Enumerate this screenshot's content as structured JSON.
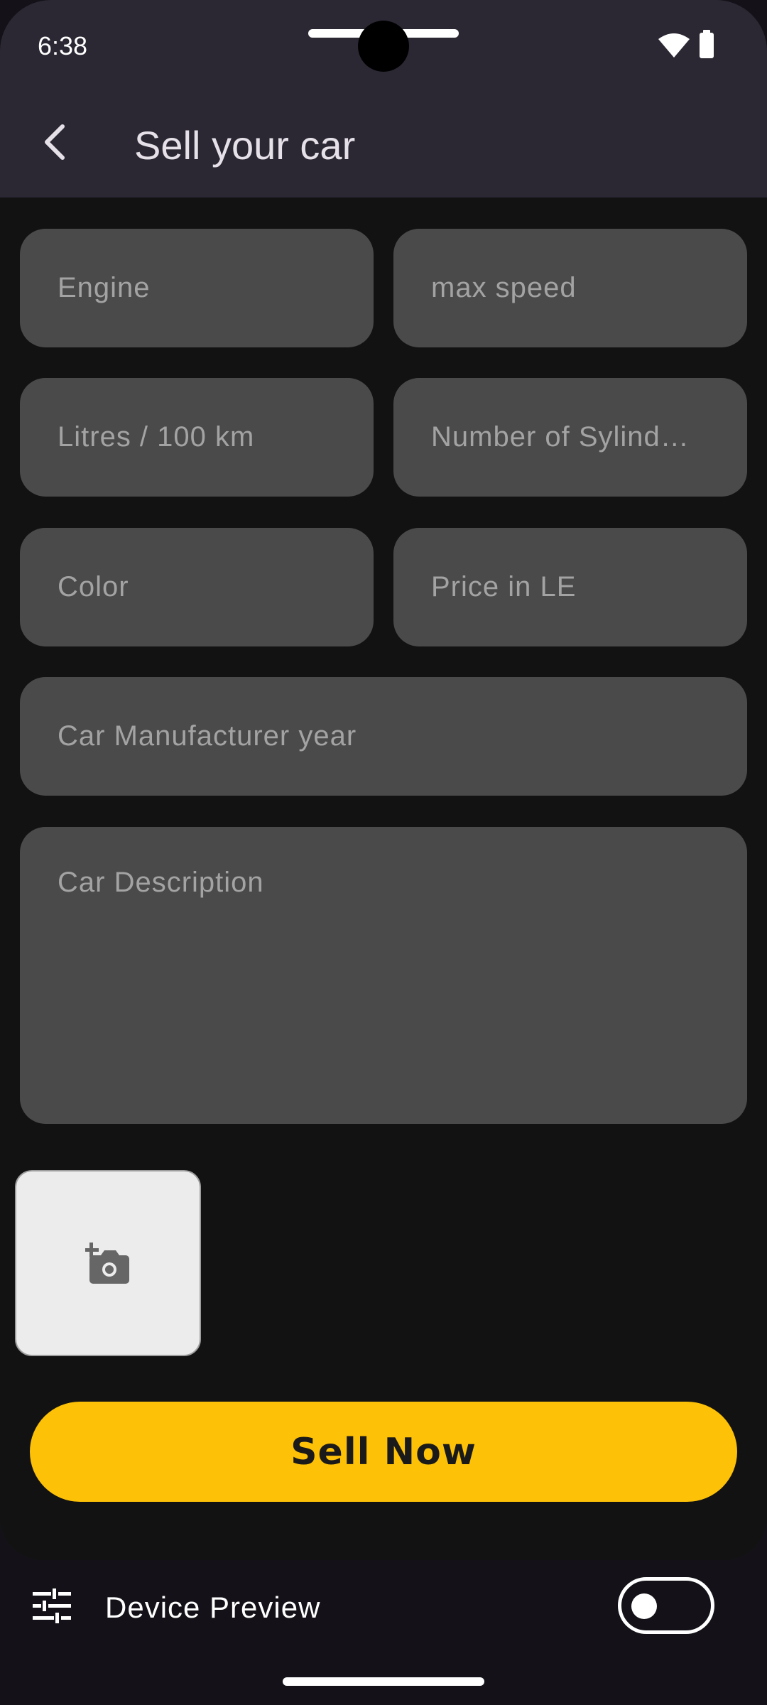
{
  "status_bar": {
    "time": "6:38",
    "icons": [
      "wifi-icon",
      "battery-icon"
    ]
  },
  "app_bar": {
    "back_icon": "chevron-left-icon",
    "title": "Sell your car"
  },
  "form": {
    "engine_placeholder": "Engine",
    "max_speed_placeholder": "max speed",
    "litres_placeholder": "Litres / 100 km",
    "cylinders_placeholder": "Number of Sylind…",
    "color_placeholder": "Color",
    "price_placeholder": "Price in LE",
    "year_placeholder": "Car Manufacturer year",
    "description_placeholder": "Car Description",
    "photo_icon": "add-photo-icon"
  },
  "actions": {
    "sell_label": "Sell Now"
  },
  "device_preview": {
    "label": "Device Preview",
    "icon": "tune-icon",
    "toggle_on": false
  },
  "colors": {
    "accent": "#FDC107",
    "field_background": "#4A4A4A",
    "background": "#121212",
    "app_bar": "#2B2834"
  }
}
